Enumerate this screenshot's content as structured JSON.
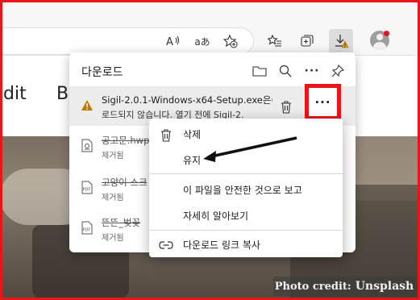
{
  "toolbar": {
    "icons": [
      "read-aloud-icon",
      "translate-icon",
      "add-favorite-icon",
      "favorites-icon",
      "collections-icon",
      "downloads-icon",
      "profile-icon"
    ],
    "read_aloud_glyph": "A",
    "translate_glyph": "aあ"
  },
  "page": {
    "nav_left": "dit",
    "nav_mid": "B",
    "credit_prefix": "Photo credit:",
    "credit_brand": "Unsplash"
  },
  "downloads": {
    "title": "다운로드",
    "items": [
      {
        "name": "Sigil-2.0.1-Windows-x64-Setup.exe은(",
        "status": "로드되지 않습니다. 열기 전에 Sigil-2.",
        "icon": "warning-icon"
      },
      {
        "name": "공고문.hwp",
        "status": "제거됨",
        "icon": "document-icon"
      },
      {
        "name": "고양이 스크",
        "status": "제거됨",
        "icon": "pdf-icon"
      },
      {
        "name": "뜬뜬_벚꽃",
        "status": "제거됨",
        "icon": "pdf-icon"
      }
    ]
  },
  "context_menu": {
    "delete": "삭제",
    "keep": "유지",
    "report_safe": "이 파일을 안전한 것으로 보고",
    "learn_more": "자세히 알아보기",
    "copy_link": "다운로드 링크 복사"
  },
  "colors": {
    "highlight": "#e8161b",
    "warning": "#c07a00"
  }
}
